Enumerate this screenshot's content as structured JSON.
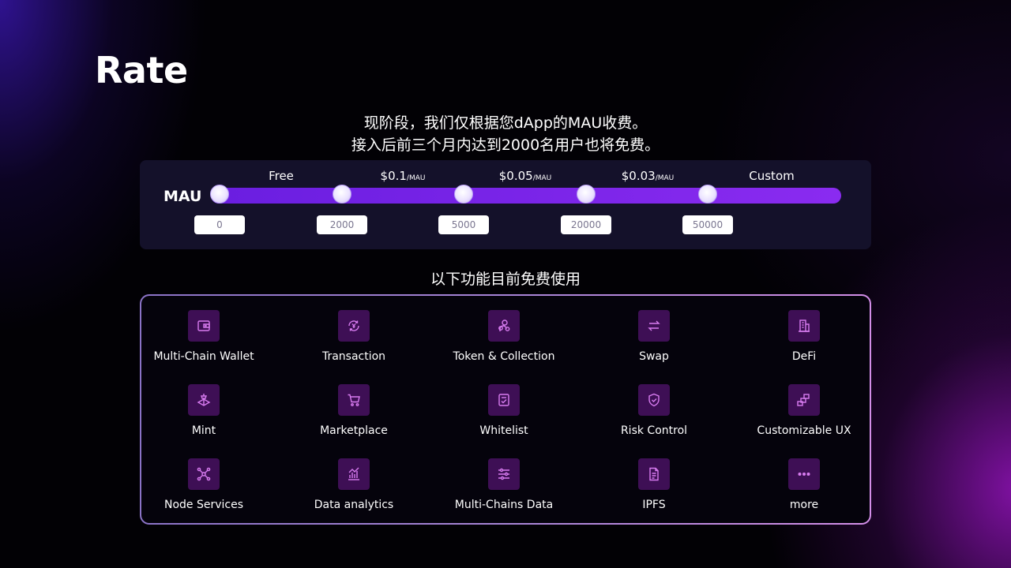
{
  "title": "Rate",
  "subtitle_line1": "现阶段，我们仅根据您dApp的MAU收费。",
  "subtitle_line2": "接入后前三个月内达到2000名用户也将免费。",
  "pricing": {
    "mau_label": "MAU",
    "tiers": [
      {
        "price": "Free",
        "unit": ""
      },
      {
        "price": "$0.1",
        "unit": "/MAU"
      },
      {
        "price": "$0.05",
        "unit": "/MAU"
      },
      {
        "price": "$0.03",
        "unit": "/MAU"
      },
      {
        "price": "Custom",
        "unit": ""
      }
    ],
    "thresholds": [
      "0",
      "2000",
      "5000",
      "20000",
      "50000"
    ]
  },
  "features_heading": "以下功能目前免费使用",
  "features": [
    {
      "label": "Multi-Chain Wallet",
      "icon": "wallet-icon"
    },
    {
      "label": "Transaction",
      "icon": "transaction-icon"
    },
    {
      "label": "Token & Collection",
      "icon": "token-collection-icon"
    },
    {
      "label": "Swap",
      "icon": "swap-icon"
    },
    {
      "label": "DeFi",
      "icon": "defi-icon"
    },
    {
      "label": "Mint",
      "icon": "mint-icon"
    },
    {
      "label": "Marketplace",
      "icon": "cart-icon"
    },
    {
      "label": "Whitelist",
      "icon": "checklist-icon"
    },
    {
      "label": "Risk Control",
      "icon": "shield-icon"
    },
    {
      "label": "Customizable UX",
      "icon": "blocks-icon"
    },
    {
      "label": "Node Services",
      "icon": "network-icon"
    },
    {
      "label": "Data analytics",
      "icon": "analytics-icon"
    },
    {
      "label": "Multi-Chains Data",
      "icon": "sliders-icon"
    },
    {
      "label": "IPFS",
      "icon": "document-icon"
    },
    {
      "label": "more",
      "icon": "more-icon"
    }
  ],
  "colors": {
    "accent_purple": "#7b24ea",
    "icon_tile": "#3e0f55",
    "icon_stroke": "#d87cf0",
    "card_bg": "#14112a"
  }
}
